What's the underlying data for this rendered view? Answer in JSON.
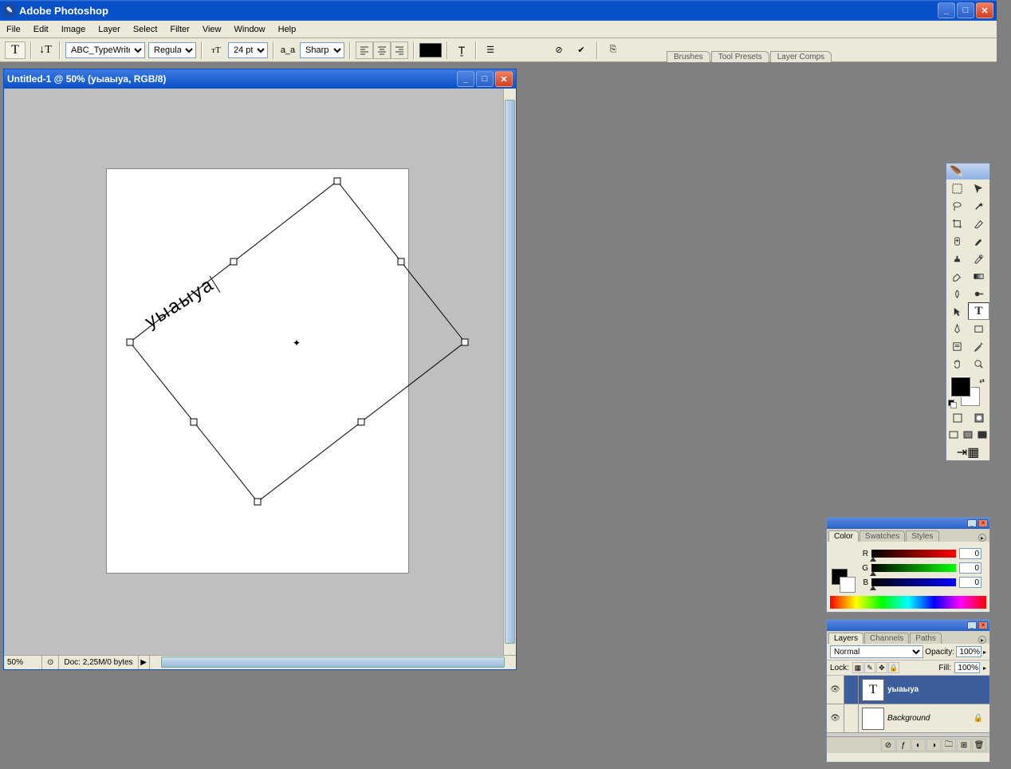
{
  "app": {
    "title": "Adobe Photoshop"
  },
  "menu": [
    "File",
    "Edit",
    "Image",
    "Layer",
    "Select",
    "Filter",
    "View",
    "Window",
    "Help"
  ],
  "options": {
    "font_family": "ABC_TypeWriter...",
    "font_style": "Regular",
    "font_size": "24 pt",
    "aa_label": "a_a",
    "anti_alias": "Sharp",
    "color": "#000000"
  },
  "palette_dock_tabs": [
    "Brushes",
    "Tool Presets",
    "Layer Comps"
  ],
  "document": {
    "title": "Untitled-1 @ 50% (уыаыуа, RGB/8)",
    "text": "уыаыуа",
    "zoom": "50%",
    "info": "Doc: 2,25M/0 bytes"
  },
  "color_panel": {
    "tabs": [
      "Color",
      "Swatches",
      "Styles"
    ],
    "channels": [
      {
        "label": "R",
        "value": "0"
      },
      {
        "label": "G",
        "value": "0"
      },
      {
        "label": "B",
        "value": "0"
      }
    ]
  },
  "layers_panel": {
    "tabs": [
      "Layers",
      "Channels",
      "Paths"
    ],
    "blend_mode": "Normal",
    "opacity_label": "Opacity:",
    "opacity_value": "100%",
    "lock_label": "Lock:",
    "fill_label": "Fill:",
    "fill_value": "100%",
    "layers": [
      {
        "name": "уыаыуа",
        "type": "text",
        "active": true
      },
      {
        "name": "Background",
        "type": "bg",
        "active": false,
        "locked": true
      }
    ]
  }
}
